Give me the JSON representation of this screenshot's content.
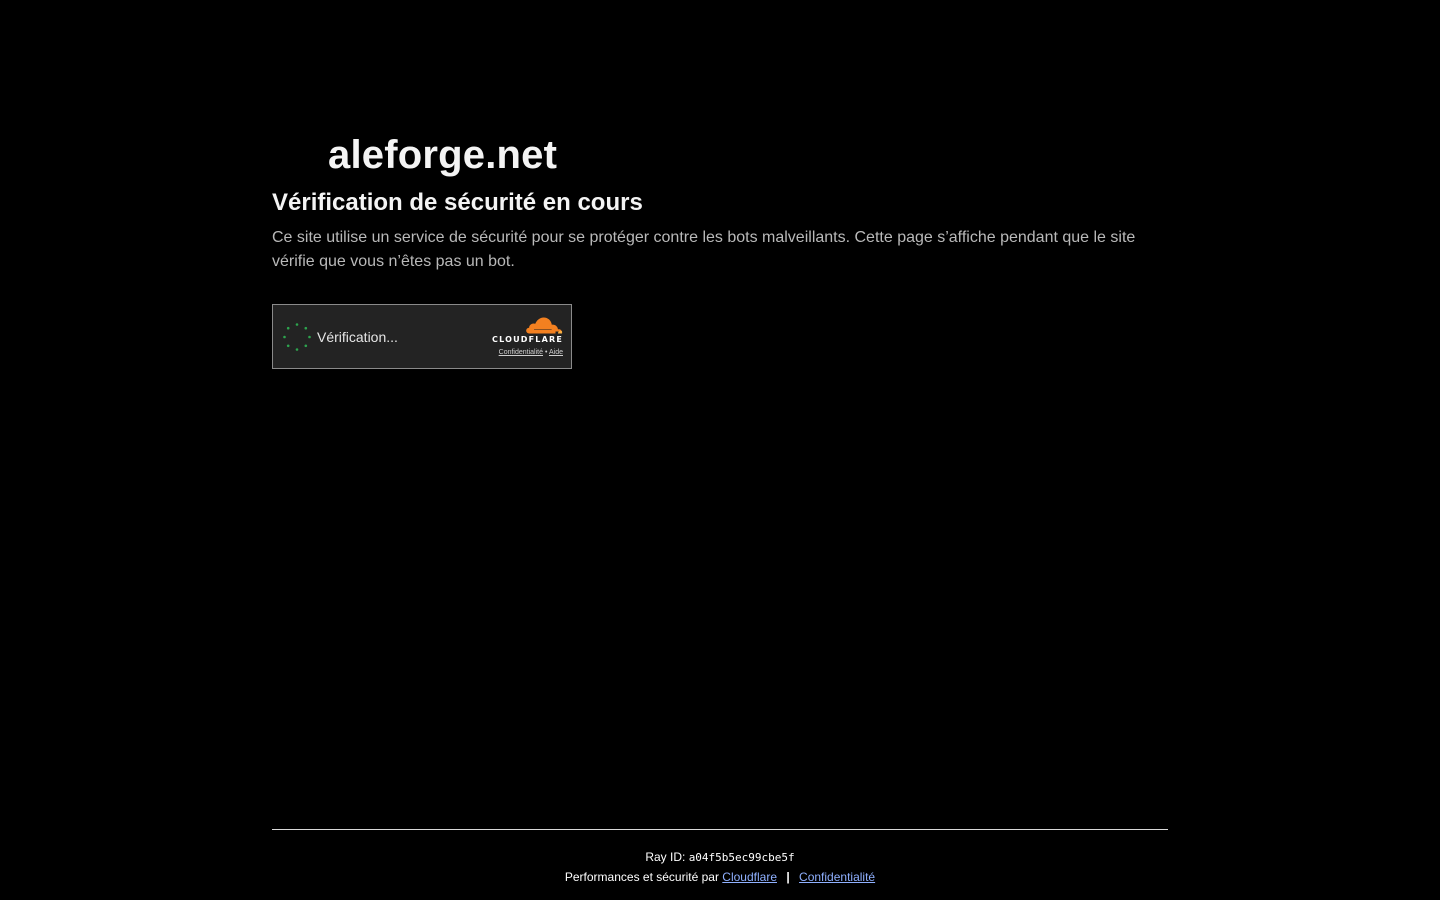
{
  "site": {
    "name": "aleforge.net"
  },
  "main": {
    "heading": "Vérification de sécurité en cours",
    "description": "Ce site utilise un service de sécurité pour se protéger contre les bots malveillants. Cette page s’affiche pendant que le site vérifie que vous n’êtes pas un bot."
  },
  "widget": {
    "status_text": "Vérification...",
    "spinner_icon": "loading-spinner-icon",
    "brand": "CLOUDFLARE",
    "brand_icon": "cloudflare-cloud-icon",
    "privacy_link": "Confidentialité",
    "link_separator": "•",
    "help_link": "Aide",
    "colors": {
      "spinner": "#2da44e",
      "cloud": "#f38020",
      "background": "#232323",
      "border": "#8a8a8a"
    }
  },
  "footer": {
    "ray_label": "Ray ID:",
    "ray_id": "a04f5b5ec99cbe5f",
    "performance_text": "Performances et sécurité par",
    "cloudflare_link": "Cloudflare",
    "separator": "|",
    "privacy_link": "Confidentialité",
    "link_color": "#8fb0ff"
  }
}
